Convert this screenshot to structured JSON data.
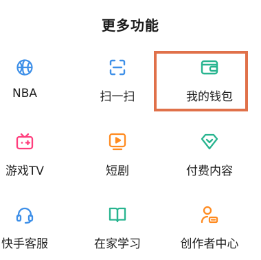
{
  "title": "更多功能",
  "items": [
    {
      "label": "NBA",
      "icon": "basketball-icon"
    },
    {
      "label": "扫一扫",
      "icon": "scan-icon"
    },
    {
      "label": "我的钱包",
      "icon": "wallet-icon"
    },
    {
      "label": "游戏TV",
      "icon": "game-tv-icon"
    },
    {
      "label": "短剧",
      "icon": "short-drama-icon"
    },
    {
      "label": "付费内容",
      "icon": "paid-content-icon"
    },
    {
      "label": "快手客服",
      "icon": "customer-service-icon"
    },
    {
      "label": "在家学习",
      "icon": "book-icon"
    },
    {
      "label": "创作者中心",
      "icon": "creator-center-icon"
    }
  ],
  "colors": {
    "blue": "#3d8fe8",
    "green": "#27b48f",
    "pink": "#ff3e7d",
    "orange": "#ff8a1f",
    "highlight": "#e0714a"
  }
}
